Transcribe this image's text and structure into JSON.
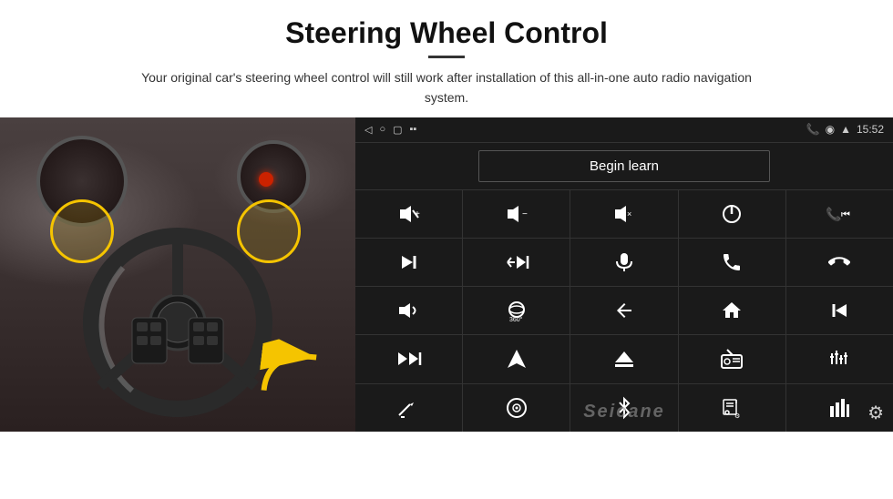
{
  "header": {
    "title": "Steering Wheel Control",
    "subtitle": "Your original car's steering wheel control will still work after installation of this all-in-one auto radio navigation system."
  },
  "status_bar": {
    "time": "15:52",
    "icons": [
      "back-arrow",
      "home-circle",
      "square",
      "battery-signal"
    ]
  },
  "begin_learn": {
    "label": "Begin learn"
  },
  "controls": [
    {
      "icon": "🔊+",
      "name": "vol-up"
    },
    {
      "icon": "🔊−",
      "name": "vol-down"
    },
    {
      "icon": "🔇",
      "name": "mute"
    },
    {
      "icon": "⏻",
      "name": "power"
    },
    {
      "icon": "📞⏮",
      "name": "call-prev"
    },
    {
      "icon": "⏭",
      "name": "next-track"
    },
    {
      "icon": "✕⏭",
      "name": "skip"
    },
    {
      "icon": "🎤",
      "name": "mic"
    },
    {
      "icon": "📞",
      "name": "call"
    },
    {
      "icon": "📞↩",
      "name": "end-call"
    },
    {
      "icon": "📢",
      "name": "horn"
    },
    {
      "icon": "⚙360",
      "name": "360-camera"
    },
    {
      "icon": "↩",
      "name": "back"
    },
    {
      "icon": "🏠",
      "name": "home"
    },
    {
      "icon": "⏮⏮",
      "name": "prev-track"
    },
    {
      "icon": "⏭⏭",
      "name": "fast-forward"
    },
    {
      "icon": "▲",
      "name": "navigate"
    },
    {
      "icon": "⏏",
      "name": "eject"
    },
    {
      "icon": "📻",
      "name": "radio"
    },
    {
      "icon": "⚙⚙",
      "name": "settings-eq"
    },
    {
      "icon": "🎤✏",
      "name": "voice-edit"
    },
    {
      "icon": "⊙",
      "name": "steering"
    },
    {
      "icon": "✱",
      "name": "bluetooth"
    },
    {
      "icon": "🎵",
      "name": "music"
    },
    {
      "icon": "📊",
      "name": "equalizer"
    }
  ],
  "watermark": "Seicane",
  "toolbar": {
    "gear_label": "⚙"
  }
}
